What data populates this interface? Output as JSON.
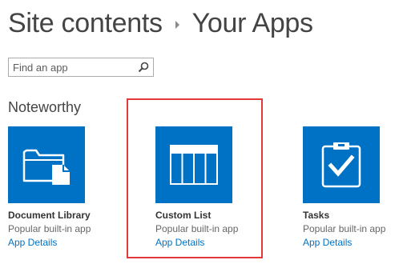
{
  "header": {
    "breadcrumb_root": "Site contents",
    "breadcrumb_current": "Your Apps"
  },
  "search": {
    "placeholder": "Find an app",
    "value": ""
  },
  "section": {
    "title": "Noteworthy"
  },
  "apps": [
    {
      "name": "Document Library",
      "subtitle": "Popular built-in app",
      "link": "App Details",
      "icon": "document-library-icon"
    },
    {
      "name": "Custom List",
      "subtitle": "Popular built-in app",
      "link": "App Details",
      "icon": "custom-list-icon"
    },
    {
      "name": "Tasks",
      "subtitle": "Popular built-in app",
      "link": "App Details",
      "icon": "tasks-icon"
    }
  ],
  "colors": {
    "tile": "#0072c6",
    "link": "#0072c6",
    "highlight": "#e03a3a"
  }
}
